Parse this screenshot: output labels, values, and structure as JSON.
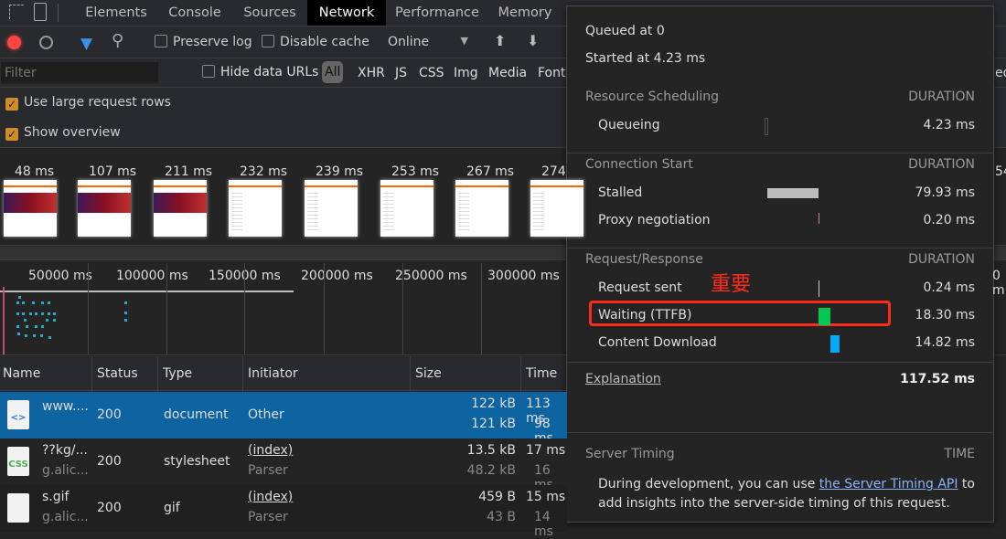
{
  "tabs": {
    "items": [
      "Elements",
      "Console",
      "Sources",
      "Network",
      "Performance",
      "Memory"
    ],
    "active": "Network"
  },
  "toolbar": {
    "preserve_log": "Preserve log",
    "disable_cache": "Disable cache",
    "throttle": "Online",
    "preserve_checked": false,
    "disable_cache_checked": false
  },
  "filterbar": {
    "placeholder": "Filter",
    "hide_data_urls": "Hide data URLs",
    "types": [
      "All",
      "XHR",
      "JS",
      "CSS",
      "Img",
      "Media",
      "Font"
    ],
    "active": "All",
    "cut_right": "ed"
  },
  "settings": {
    "large_rows": "Use large request rows",
    "show_overview": "Show overview",
    "large_rows_checked": true,
    "show_overview_checked": true
  },
  "filmstrip": {
    "times": [
      "48 ms",
      "107 ms",
      "211 ms",
      "232 ms",
      "239 ms",
      "253 ms",
      "267 ms",
      "274"
    ],
    "cut_right": "54"
  },
  "timeline": {
    "ticks": [
      "50000 ms",
      "100000 ms",
      "150000 ms",
      "200000 ms",
      "250000 ms",
      "300000 ms"
    ],
    "cut_right": "0 m"
  },
  "table": {
    "headers": [
      "Name",
      "Status",
      "Type",
      "Initiator",
      "Size",
      "Time"
    ],
    "rows": [
      {
        "icon": "html-document-icon",
        "name": "www....",
        "domain": "",
        "status": "200",
        "type": "document",
        "initiator": "Other",
        "initiator_sub": "",
        "size": "122 kB",
        "size_sub": "121 kB",
        "time": "113 ms",
        "time_sub": "98 ms",
        "selected": true
      },
      {
        "icon": "css-file-icon",
        "name": "??kg/...",
        "domain": "g.alic...",
        "status": "200",
        "type": "stylesheet",
        "initiator": "(index)",
        "initiator_sub": "Parser",
        "size": "13.5 kB",
        "size_sub": "48.2 kB",
        "time": "17 ms",
        "time_sub": "16 ms",
        "selected": false
      },
      {
        "icon": "blank-file-icon",
        "name": "s.gif",
        "domain": "g.alic...",
        "status": "200",
        "type": "gif",
        "initiator": "(index)",
        "initiator_sub": "Parser",
        "size": "459 B",
        "size_sub": "43 B",
        "time": "15 ms",
        "time_sub": "14 ms",
        "selected": false
      }
    ]
  },
  "timing": {
    "queued": "Queued at 0",
    "started": "Started at 4.23 ms",
    "duration_label": "DURATION",
    "sections": [
      {
        "title": "Resource Scheduling",
        "phases": [
          {
            "label": "Queueing",
            "value": "4.23 ms",
            "start_ms": 0,
            "ms": 4.23,
            "color": "outline"
          }
        ]
      },
      {
        "title": "Connection Start",
        "phases": [
          {
            "label": "Stalled",
            "value": "79.93 ms",
            "start_ms": 4.23,
            "ms": 79.93,
            "color": "#bdbdbd"
          },
          {
            "label": "Proxy negotiation",
            "value": "0.20 ms",
            "start_ms": 84.16,
            "ms": 0.2,
            "color": "#c98a8a"
          }
        ]
      },
      {
        "title": "Request/Response",
        "phases": [
          {
            "label": "Request sent",
            "value": "0.24 ms",
            "start_ms": 84.36,
            "ms": 0.24,
            "color": "#cccccc"
          },
          {
            "label": "Waiting (TTFB)",
            "value": "18.30 ms",
            "start_ms": 84.6,
            "ms": 18.3,
            "color": "#00c853"
          },
          {
            "label": "Content Download",
            "value": "14.82 ms",
            "start_ms": 102.9,
            "ms": 14.82,
            "color": "#03a9f4"
          }
        ]
      }
    ],
    "explanation": "Explanation",
    "total": "117.52 ms",
    "server_timing": "Server Timing",
    "time_label": "TIME",
    "server_text_1": "During development, you can use ",
    "server_link": "the Server Timing API",
    "server_text_2": " to",
    "server_text_3": "add insights into the server-side timing of this request.",
    "annotation": "重要",
    "annotation_color": "#ff2a1a"
  }
}
